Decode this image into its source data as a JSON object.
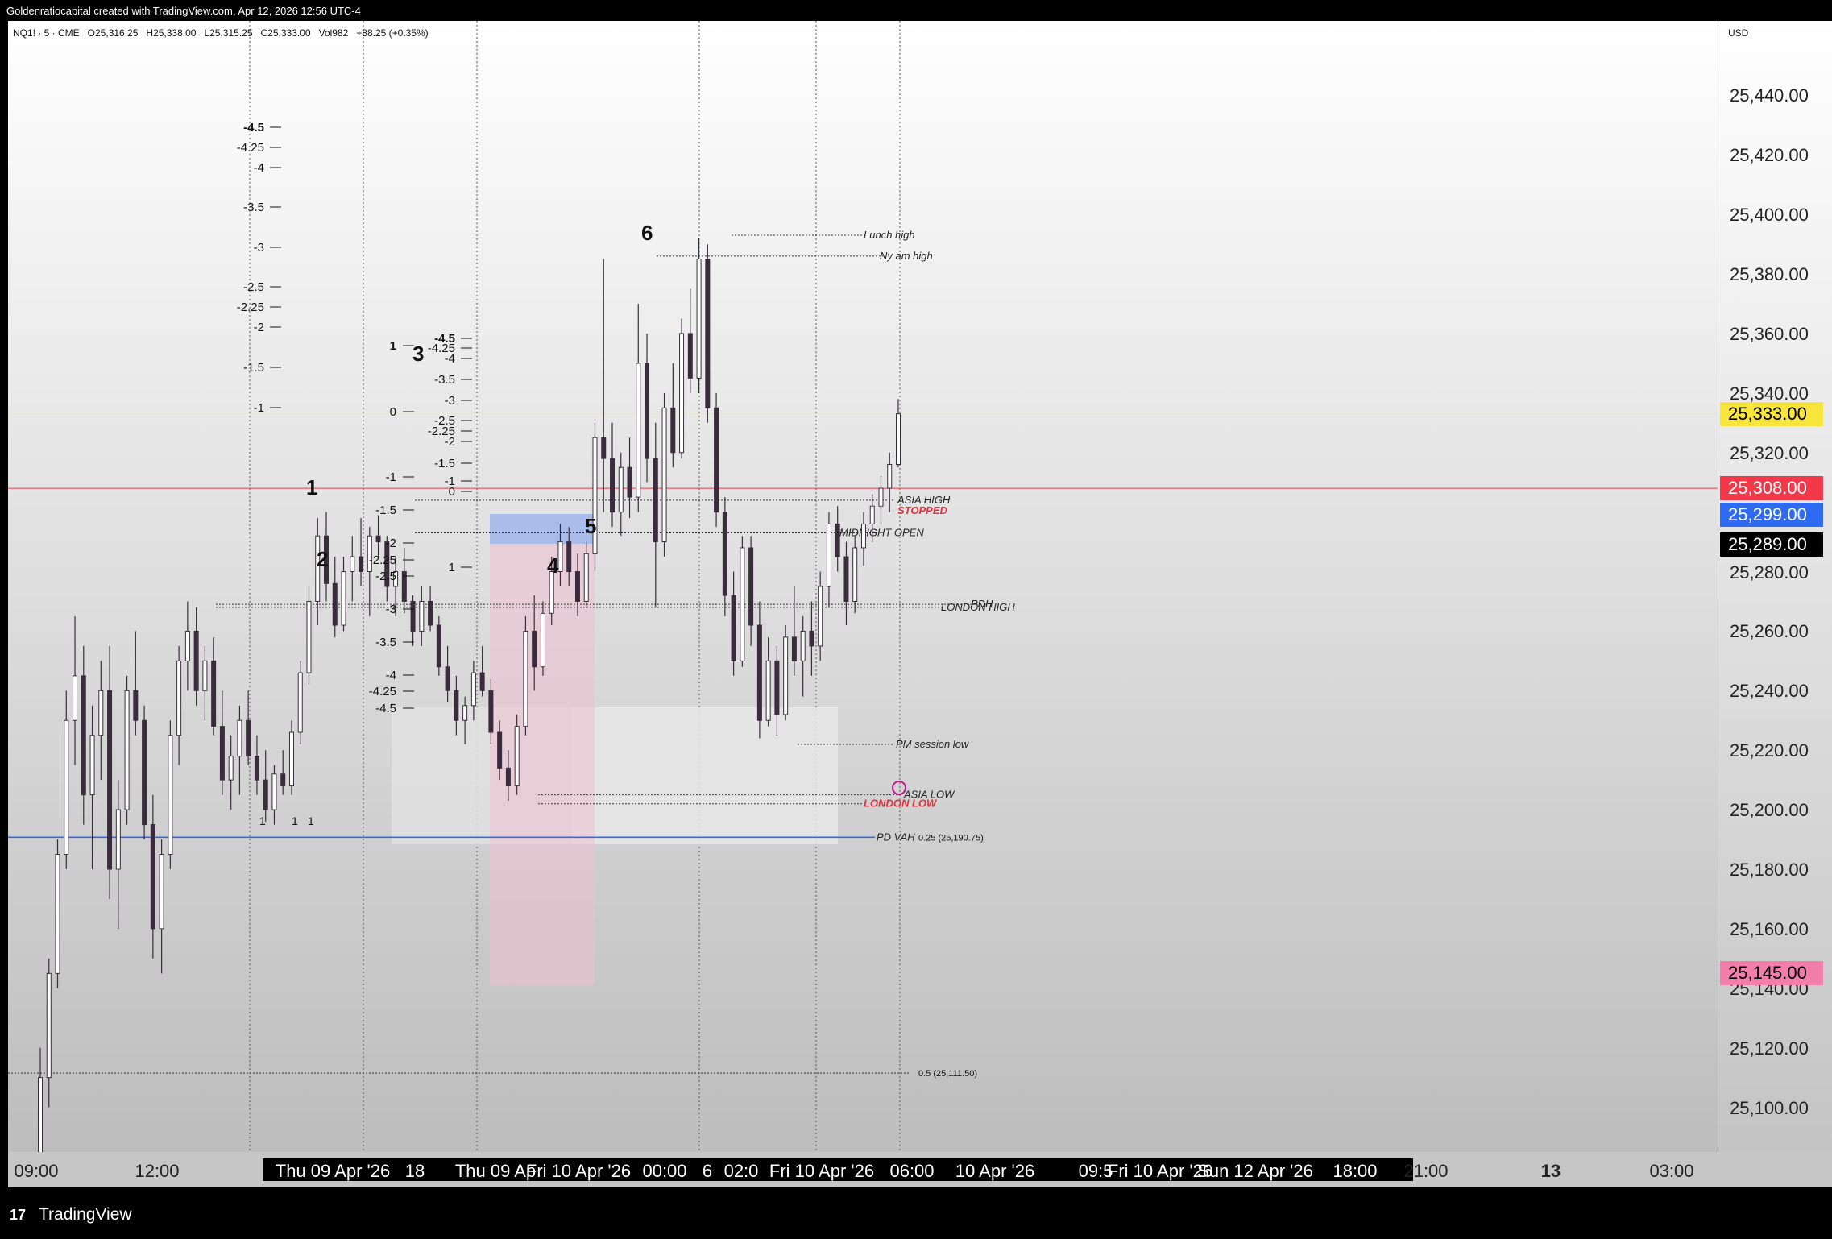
{
  "header": {
    "attribution": "Goldenratiocapital created with TradingView.com, Apr 12, 2026 12:56 UTC-4",
    "legend": "NQ1! · 5 · CME   O25,316.25   H25,338.00   L25,315.25   C25,333.00   Vol982   +88.25 (+0.35%)"
  },
  "price_axis": {
    "currency": "USD",
    "ticks": [
      "25,440.00",
      "25,420.00",
      "25,400.00",
      "25,380.00",
      "25,360.00",
      "25,340.00",
      "25,320.00",
      "25,280.00",
      "25,260.00",
      "25,240.00",
      "25,220.00",
      "25,200.00",
      "25,180.00",
      "25,160.00",
      "25,140.00",
      "25,120.00",
      "25,100.00"
    ],
    "badges": [
      {
        "text": "25,333.00",
        "bg": "#f7e53b",
        "fg": "#000000",
        "price": 25333
      },
      {
        "text": "25,308.00",
        "bg": "#f2394a",
        "fg": "#ffffff",
        "price": 25308
      },
      {
        "text": "25,299.00",
        "bg": "#2e6bf0",
        "fg": "#ffffff",
        "price": 25299
      },
      {
        "text": "25,289.00",
        "bg": "#000000",
        "fg": "#ffffff",
        "price": 25289
      },
      {
        "text": "25,145.00",
        "bg": "#f27ea9",
        "fg": "#000000",
        "price": 25145
      }
    ]
  },
  "time_axis": {
    "labels": [
      "09:00",
      "12:00",
      "Thu 09 Apr '26",
      "18",
      "Thu 09 Ap",
      "Fri 10 Apr '26",
      "00:00",
      "6",
      "02:0",
      "Fri 10 Apr '26",
      "06:00",
      "10 Apr '26",
      "09:5",
      "Fri 10 Apr '26",
      "Sun 12 Apr '26",
      "18:00",
      "21:00",
      "13",
      "03:00"
    ]
  },
  "footer": {
    "brand": "TradingView"
  },
  "annotations": {
    "waves": [
      "1",
      "2",
      "3",
      "4",
      "5",
      "6"
    ],
    "levels": [
      "Lunch high",
      "Ny am high",
      "ASIA HIGH",
      "STOPPED",
      "MIDNIGHT OPEN",
      "PDH",
      "LONDON HIGH",
      "PM session low",
      "ASIA LOW",
      "LONDON LOW",
      "PD VAH"
    ],
    "fib_left": [
      "-4.5",
      "-4.25",
      "-4",
      "-3.5",
      "-3",
      "-2.5",
      "-2.25",
      "-2",
      "-1.5",
      "-1"
    ],
    "fib_mid": [
      "-4.5",
      "-4.25",
      "-4",
      "-3.5",
      "-3",
      "-2.5",
      "-2.25",
      "-2",
      "-1.5",
      "-1",
      "0",
      "1"
    ],
    "fib_pink": [
      "1",
      "0",
      "-1",
      "-1.5",
      "-2",
      "-2.25",
      "-2.5",
      "-3",
      "-3.5",
      "-4",
      "-4.25",
      "-4.5"
    ],
    "fib_ratio_labels": [
      "0.25 (25,190.75)",
      "0.5 (25,111.50)"
    ],
    "small_ones": [
      "1",
      "1",
      "1"
    ]
  },
  "chart_data": {
    "type": "candlestick",
    "symbol": "NQ1!",
    "timeframe": "5",
    "exchange": "CME",
    "last": {
      "open": 25316.25,
      "high": 25338.0,
      "low": 25315.25,
      "close": 25333.0,
      "volume": 982,
      "change": "+88.25 (+0.35%)"
    },
    "ylim": [
      25085,
      25465
    ],
    "candles": [
      [
        25080,
        25120,
        25080,
        25110
      ],
      [
        25110,
        25150,
        25100,
        25145
      ],
      [
        25145,
        25190,
        25140,
        25185
      ],
      [
        25185,
        25240,
        25180,
        25230
      ],
      [
        25230,
        25265,
        25215,
        25245
      ],
      [
        25245,
        25255,
        25195,
        25205
      ],
      [
        25205,
        25235,
        25180,
        25225
      ],
      [
        25225,
        25250,
        25210,
        25240
      ],
      [
        25240,
        25255,
        25170,
        25180
      ],
      [
        25180,
        25210,
        25160,
        25200
      ],
      [
        25200,
        25245,
        25195,
        25240
      ],
      [
        25240,
        25260,
        25225,
        25230
      ],
      [
        25230,
        25235,
        25190,
        25195
      ],
      [
        25195,
        25205,
        25150,
        25160
      ],
      [
        25160,
        25190,
        25145,
        25185
      ],
      [
        25185,
        25230,
        25180,
        25225
      ],
      [
        25225,
        25255,
        25215,
        25250
      ],
      [
        25250,
        25270,
        25240,
        25260
      ],
      [
        25260,
        25268,
        25235,
        25240
      ],
      [
        25240,
        25255,
        25230,
        25250
      ],
      [
        25250,
        25258,
        25225,
        25228
      ],
      [
        25228,
        25240,
        25205,
        25210
      ],
      [
        25210,
        25225,
        25200,
        25218
      ],
      [
        25218,
        25235,
        25205,
        25230
      ],
      [
        25230,
        25240,
        25215,
        25218
      ],
      [
        25218,
        25225,
        25205,
        25210
      ],
      [
        25210,
        25220,
        25196,
        25200
      ],
      [
        25200,
        25215,
        25195,
        25212
      ],
      [
        25212,
        25220,
        25205,
        25208
      ],
      [
        25208,
        25230,
        25205,
        25226
      ],
      [
        25226,
        25250,
        25222,
        25246
      ],
      [
        25246,
        25275,
        25242,
        25270
      ],
      [
        25270,
        25298,
        25262,
        25292
      ],
      [
        25292,
        25300,
        25270,
        25276
      ],
      [
        25276,
        25285,
        25258,
        25262
      ],
      [
        25262,
        25285,
        25260,
        25280
      ],
      [
        25280,
        25292,
        25270,
        25285
      ],
      [
        25285,
        25298,
        25275,
        25280
      ],
      [
        25280,
        25295,
        25265,
        25292
      ],
      [
        25292,
        25299,
        25285,
        25290
      ],
      [
        25290,
        25292,
        25270,
        25275
      ],
      [
        25275,
        25285,
        25265,
        25280
      ],
      [
        25280,
        25288,
        25266,
        25270
      ],
      [
        25270,
        25272,
        25255,
        25260
      ],
      [
        25260,
        25275,
        25255,
        25270
      ],
      [
        25270,
        25275,
        25260,
        25262
      ],
      [
        25262,
        25265,
        25245,
        25248
      ],
      [
        25248,
        25255,
        25236,
        25240
      ],
      [
        25240,
        25245,
        25225,
        25230
      ],
      [
        25230,
        25238,
        25222,
        25235
      ],
      [
        25235,
        25250,
        25230,
        25246
      ],
      [
        25246,
        25255,
        25238,
        25240
      ],
      [
        25240,
        25244,
        25222,
        25226
      ],
      [
        25226,
        25230,
        25210,
        25214
      ],
      [
        25214,
        25220,
        25203,
        25208
      ],
      [
        25208,
        25232,
        25205,
        25228
      ],
      [
        25228,
        25265,
        25225,
        25260
      ],
      [
        25260,
        25272,
        25240,
        25248
      ],
      [
        25248,
        25270,
        25245,
        25266
      ],
      [
        25266,
        25285,
        25262,
        25280
      ],
      [
        25280,
        25296,
        25275,
        25290
      ],
      [
        25290,
        25295,
        25275,
        25280
      ],
      [
        25280,
        25286,
        25265,
        25270
      ],
      [
        25270,
        25290,
        25268,
        25286
      ],
      [
        25286,
        25330,
        25280,
        25325
      ],
      [
        25325,
        25385,
        25300,
        25318
      ],
      [
        25318,
        25330,
        25295,
        25300
      ],
      [
        25300,
        25320,
        25292,
        25315
      ],
      [
        25315,
        25325,
        25298,
        25305
      ],
      [
        25305,
        25370,
        25300,
        25350
      ],
      [
        25350,
        25360,
        25310,
        25318
      ],
      [
        25318,
        25330,
        25268,
        25290
      ],
      [
        25290,
        25340,
        25285,
        25335
      ],
      [
        25335,
        25350,
        25315,
        25320
      ],
      [
        25320,
        25365,
        25318,
        25360
      ],
      [
        25360,
        25375,
        25340,
        25345
      ],
      [
        25345,
        25392,
        25340,
        25385
      ],
      [
        25385,
        25390,
        25330,
        25335
      ],
      [
        25335,
        25340,
        25295,
        25300
      ],
      [
        25300,
        25305,
        25265,
        25272
      ],
      [
        25272,
        25280,
        25245,
        25250
      ],
      [
        25250,
        25292,
        25248,
        25288
      ],
      [
        25288,
        25292,
        25255,
        25262
      ],
      [
        25262,
        25270,
        25224,
        25230
      ],
      [
        25230,
        25258,
        25228,
        25250
      ],
      [
        25250,
        25255,
        25225,
        25232
      ],
      [
        25232,
        25262,
        25230,
        25258
      ],
      [
        25258,
        25275,
        25245,
        25250
      ],
      [
        25250,
        25265,
        25238,
        25260
      ],
      [
        25260,
        25270,
        25245,
        25255
      ],
      [
        25255,
        25280,
        25250,
        25275
      ],
      [
        25275,
        25300,
        25268,
        25296
      ],
      [
        25296,
        25302,
        25280,
        25285
      ],
      [
        25285,
        25290,
        25262,
        25270
      ],
      [
        25270,
        25292,
        25266,
        25288
      ],
      [
        25288,
        25300,
        25282,
        25296
      ],
      [
        25296,
        25306,
        25290,
        25302
      ],
      [
        25302,
        25312,
        25296,
        25308
      ],
      [
        25308,
        25320,
        25300,
        25316
      ],
      [
        25316,
        25338,
        25315,
        25333
      ]
    ],
    "levels": [
      {
        "name": "Lunch high",
        "price": 25393
      },
      {
        "name": "Ny am high",
        "price": 25386
      },
      {
        "name": "ASIA HIGH",
        "price": 25304
      },
      {
        "name": "MIDNIGHT OPEN",
        "price": 25293
      },
      {
        "name": "PDH",
        "price": 25269
      },
      {
        "name": "LONDON HIGH",
        "price": 25268
      },
      {
        "name": "PM session low",
        "price": 25222
      },
      {
        "name": "ASIA LOW",
        "price": 25205
      },
      {
        "name": "LONDON LOW",
        "price": 25202
      },
      {
        "name": "PD VAH",
        "price": 25190.75
      },
      {
        "name": "0.5",
        "price": 25111.5
      }
    ],
    "colors": {
      "up": "#ffffff",
      "down": "#3a2c3d",
      "wick": "#3a2c3d",
      "pd_vah": "#2e6bf0",
      "last_price_line": "#f2394a"
    }
  }
}
